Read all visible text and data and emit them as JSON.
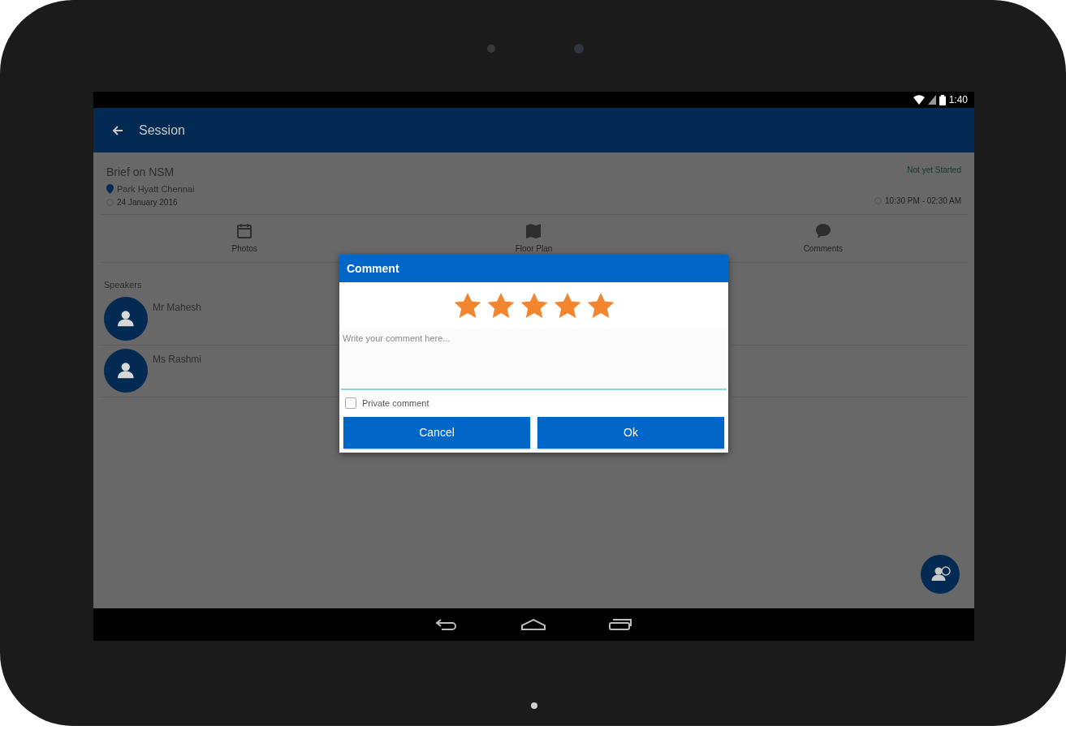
{
  "status_bar": {
    "time": "1:40"
  },
  "app_bar": {
    "title": "Session"
  },
  "session": {
    "title": "Brief on NSM",
    "venue": "Park Hyatt Chennai",
    "date": "24 January 2016",
    "status": "Not yet Started",
    "time": "10:30 PM - 02:30 AM"
  },
  "tabs": [
    {
      "label": "Photos",
      "kind": "calendar"
    },
    {
      "label": "Floor Plan",
      "kind": "map"
    },
    {
      "label": "Comments",
      "kind": "chat"
    }
  ],
  "speakers": {
    "heading": "Speakers",
    "items": [
      {
        "name": "Mr Mahesh"
      },
      {
        "name": "Ms Rashmi"
      }
    ]
  },
  "dialog": {
    "title": "Comment",
    "stars": 5,
    "placeholder": "Write your comment here...",
    "private": {
      "label": "Private comment",
      "checked": false
    },
    "buttons": [
      "Cancel",
      "Ok"
    ]
  }
}
